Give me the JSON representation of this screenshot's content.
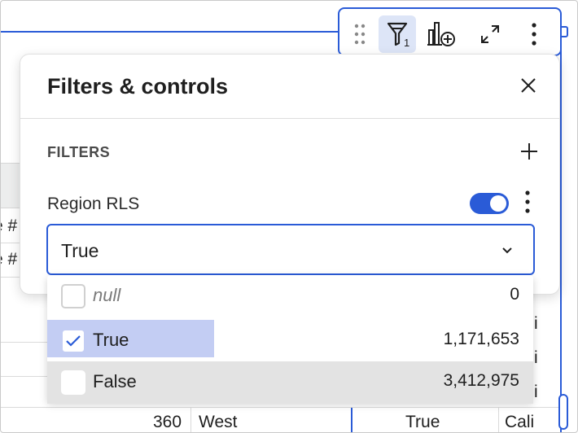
{
  "toolbar": {
    "filter_count": "1"
  },
  "panel": {
    "title": "Filters & controls",
    "section_label": "FILTERS",
    "filter": {
      "name": "Region RLS",
      "enabled": true,
      "selected_value": "True"
    }
  },
  "dropdown": {
    "options": [
      {
        "label": "null",
        "count": "0",
        "checked": false
      },
      {
        "label": "True",
        "count": "1,171,653",
        "checked": true
      },
      {
        "label": "False",
        "count": "3,412,975",
        "checked": false
      }
    ]
  },
  "background": {
    "truncated_header_1": "e #",
    "truncated_header_2": "e #",
    "strip_chars": [
      "i",
      "i",
      "i"
    ],
    "bottom_row": {
      "number": "360",
      "region": "West",
      "flag": "True",
      "partial": "Cali"
    }
  },
  "colors": {
    "accent": "#2a5bd7",
    "selected_option_bg": "#c3cdf3",
    "hover_option_bg": "#e3e3e3"
  },
  "icons": [
    "drag-handle-icon",
    "filter-icon",
    "add-chart-icon",
    "expand-icon",
    "more-vertical-icon",
    "close-icon",
    "plus-icon",
    "chevron-down-icon",
    "checkmark-icon"
  ]
}
